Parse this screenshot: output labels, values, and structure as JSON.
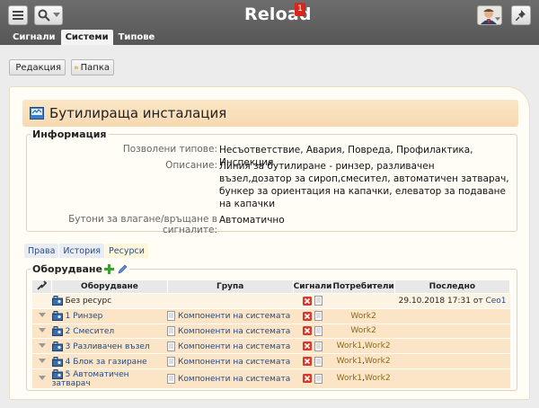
{
  "app": {
    "title": "Reload",
    "badge": "1"
  },
  "tabs": [
    {
      "label": "Сигнали",
      "active": false
    },
    {
      "label": "Системи",
      "active": true
    },
    {
      "label": "Типове",
      "active": false
    }
  ],
  "toolbar": {
    "edit_label": "Редакция",
    "folder_label": "Папка"
  },
  "system": {
    "title": "Бутилираща инсталация"
  },
  "info": {
    "legend": "Информация",
    "allowed_types_label": "Позволени типове:",
    "allowed_types_value": "Несъответствие, Авария, Повреда, Профилактика, Инспекция",
    "description_label": "Описание:",
    "description_lines": [
      "Линия за бутилиране - ринзер, разливачен",
      "възел,дозатор за сироп,смесител, автоматичен затварач,",
      "бункер за ориентация на капачки, елеватор за подаване",
      "на капачки"
    ],
    "buttons_label": "Бутони за влагане/връщане в сигналите:",
    "buttons_value": "Автоматично"
  },
  "subtabs": [
    {
      "label": "Права",
      "active": false
    },
    {
      "label": "История",
      "active": false
    },
    {
      "label": "Ресурси",
      "active": true
    }
  ],
  "equipment": {
    "legend": "Оборудване",
    "columns": {
      "equipment": "Оборудване",
      "group": "Група",
      "signals": "Сигнали",
      "users": "Потребители",
      "last": "Последно"
    },
    "rows": [
      {
        "name": "Без ресурс",
        "group": "",
        "users": [],
        "last": "29.10.2018 17:31 от",
        "last_user": "Ceo1"
      },
      {
        "name": "1 Ринзер",
        "group": "Компоненти на системата",
        "users": [
          "Work2"
        ],
        "last": "",
        "last_user": ""
      },
      {
        "name": "2 Смесител",
        "group": "Компоненти на системата",
        "users": [
          "Work2"
        ],
        "last": "",
        "last_user": ""
      },
      {
        "name": "3 Разливачен възел",
        "group": "Компоненти на системата",
        "users": [
          "Work1",
          "Work2"
        ],
        "last": "",
        "last_user": ""
      },
      {
        "name": "4 Блок за газиране",
        "group": "Компоненти на системата",
        "users": [
          "Work1",
          "Work2"
        ],
        "last": "",
        "last_user": ""
      },
      {
        "name": "5 Автоматичен затварач",
        "group": "Компоненти на системата",
        "users": [
          "Work1",
          "Work2"
        ],
        "last": "",
        "last_user": ""
      }
    ]
  },
  "colors": {
    "topbar": "#5f5f5f",
    "header_bg": "#f9dfbb",
    "row_bg": "#fbe5c6",
    "link": "#1d4a8a",
    "badge": "#d9261c"
  }
}
